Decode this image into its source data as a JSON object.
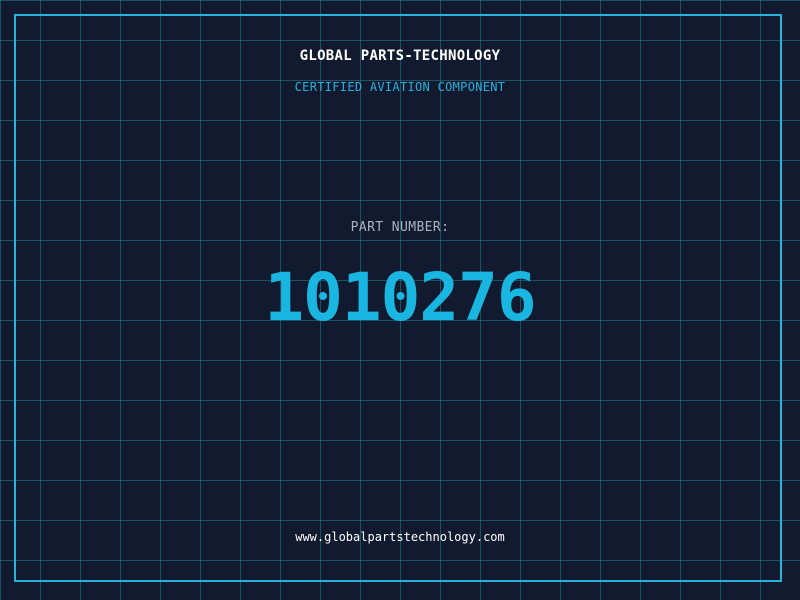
{
  "label": {
    "company": "GLOBAL PARTS-TECHNOLOGY",
    "tagline": "CERTIFIED AVIATION COMPONENT",
    "part_number_label": "PART NUMBER:",
    "part_number": "1010276",
    "website": "www.globalpartstechnology.com"
  },
  "colors": {
    "background": "#111a2e",
    "grid": "#2896aa",
    "frame": "#26b4dc",
    "accent": "#18b6e0",
    "tagline": "#2ab0de",
    "label_text": "#aab4c4",
    "primary_text": "#ffffff"
  }
}
